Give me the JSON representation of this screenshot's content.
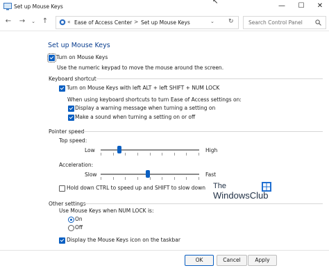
{
  "window": {
    "title": "Set up Mouse Keys",
    "controls": {
      "minimize": "—",
      "maximize": "☐",
      "close": "✕"
    }
  },
  "addressbar": {
    "crumb_separator_1": "«",
    "crumb_1": "Ease of Access Center",
    "crumb_separator_2": ">",
    "crumb_2": "Set up Mouse Keys",
    "search_placeholder": "Search Control Panel"
  },
  "page": {
    "heading": "Set up Mouse Keys",
    "turn_on": {
      "label": "Turn on Mouse Keys",
      "checked": true
    },
    "turn_on_desc": "Use the numeric keypad to move the mouse around the screen.",
    "keyboard_shortcut": {
      "section_label": "Keyboard shortcut",
      "alt_shift_numlock": {
        "label": "Turn on Mouse Keys with left ALT + left SHIFT + NUM LOCK",
        "checked": true
      },
      "sub_label": "When using keyboard shortcuts to turn Ease of Access settings on:",
      "warning": {
        "label": "Display a warning message when turning a setting on",
        "checked": true
      },
      "sound": {
        "label": "Make a sound when turning a setting on or off",
        "checked": true
      }
    },
    "pointer_speed": {
      "section_label": "Pointer speed",
      "top_speed": {
        "label": "Top speed:",
        "min_label": "Low",
        "max_label": "High",
        "level": 0.18
      },
      "acceleration": {
        "label": "Acceleration:",
        "min_label": "Slow",
        "max_label": "Fast",
        "level": 0.48
      },
      "hold_ctrl": {
        "label": "Hold down CTRL to speed up and SHIFT to slow down",
        "checked": false
      }
    },
    "other_settings": {
      "section_label": "Other settings",
      "numlock_label": "Use Mouse Keys when NUM LOCK is:",
      "options": [
        {
          "label": "On",
          "selected": true
        },
        {
          "label": "Off",
          "selected": false
        }
      ],
      "taskbar_icon": {
        "label": "Display the Mouse Keys icon on the taskbar",
        "checked": true
      }
    }
  },
  "watermark": {
    "line1": "The",
    "line2": "WindowsClub"
  },
  "buttons": {
    "ok": "OK",
    "cancel": "Cancel",
    "apply": "Apply"
  },
  "colors": {
    "accent": "#0a5fc2",
    "heading": "#0a3e8f"
  }
}
